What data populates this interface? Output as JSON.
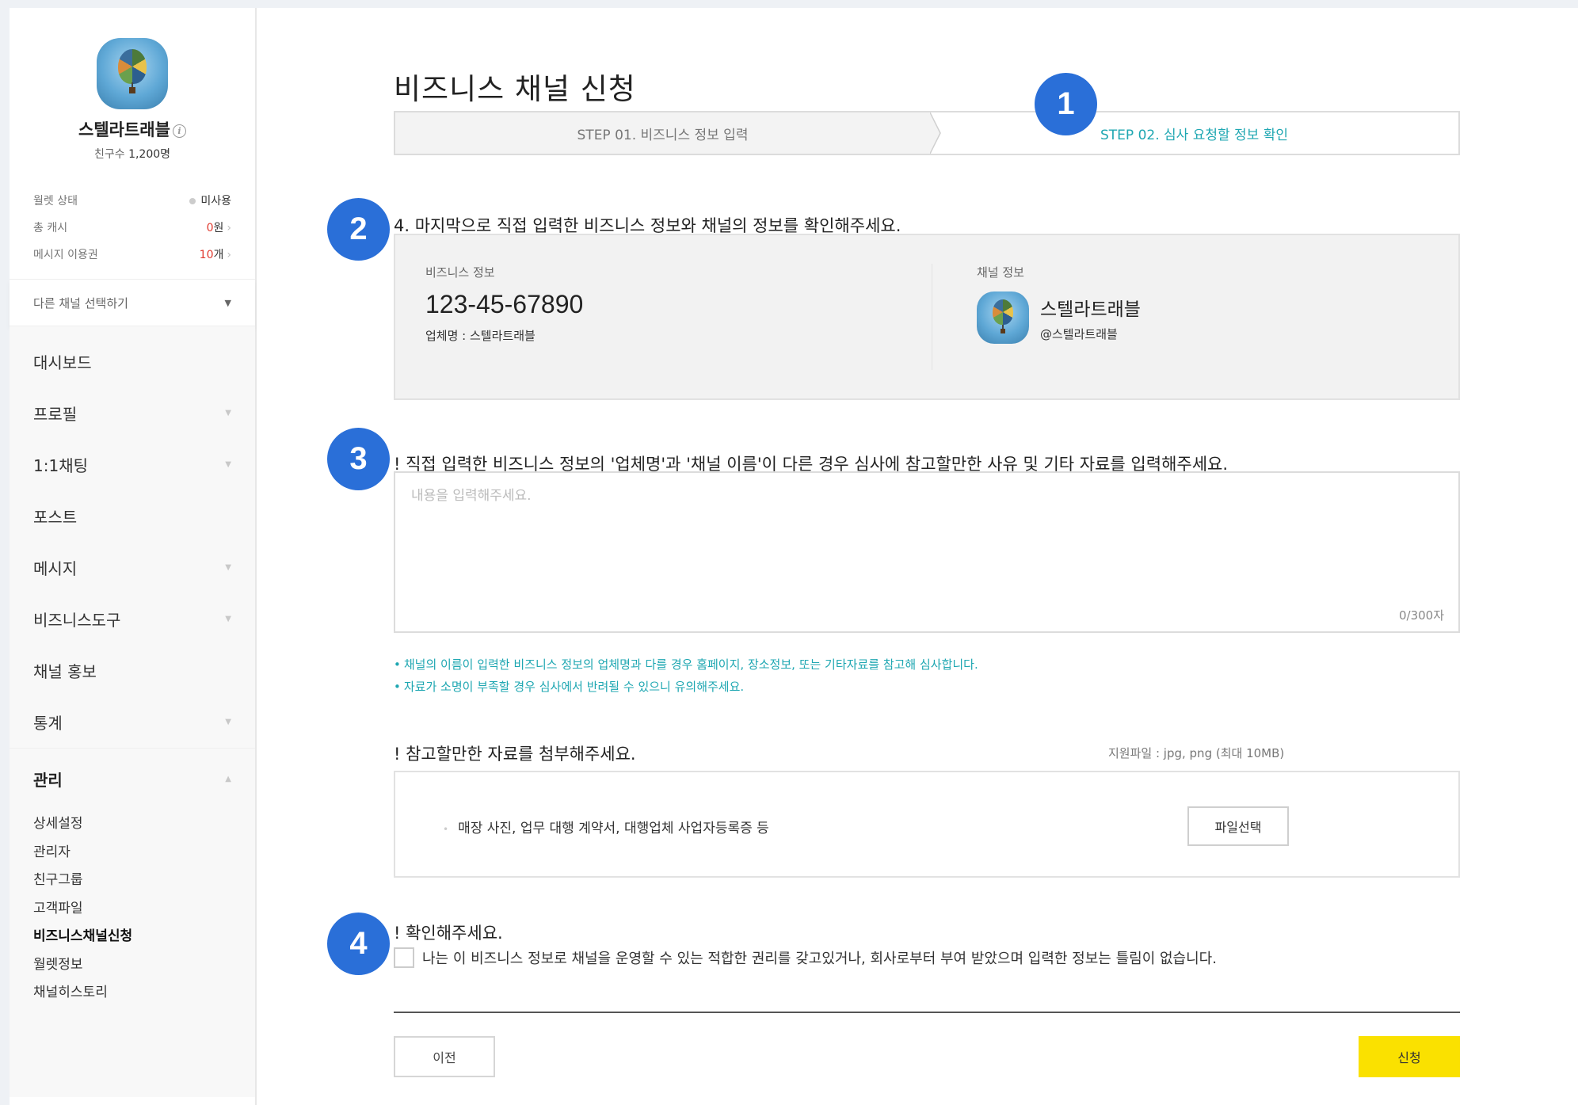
{
  "sidebar": {
    "channel_name": "스텔라트래블",
    "friends_label": "친구수",
    "friends_count": "1,200명",
    "stats": [
      {
        "label": "월렛 상태",
        "value": "미사용"
      },
      {
        "label": "총 캐시",
        "value": "0",
        "unit": "원"
      },
      {
        "label": "메시지 이용권",
        "value": "10",
        "unit": "개"
      }
    ],
    "channel_select": "다른 채널 선택하기",
    "nav": [
      "대시보드",
      "프로필",
      "1:1채팅",
      "포스트",
      "메시지",
      "비즈니스도구",
      "채널 홍보",
      "통계"
    ],
    "manage_label": "관리",
    "manage_items": [
      "상세설정",
      "관리자",
      "친구그룹",
      "고객파일",
      "비즈니스채널신청",
      "월렛정보",
      "채널히스토리"
    ]
  },
  "main": {
    "title": "비즈니스 채널 신청",
    "step1": "STEP 01. 비즈니스 정보 입력",
    "step2": "STEP 02. 심사 요청할 정보 확인",
    "badges": [
      "1",
      "2",
      "3",
      "4"
    ],
    "section4_label": "4. 마지막으로 직접 입력한 비즈니스 정보와 채널의 정보를 확인해주세요.",
    "biz_label": "비즈니스 정보",
    "biz_number": "123-45-67890",
    "biz_company": "업체명 : 스텔라트래블",
    "chan_label": "채널 정보",
    "chan_name": "스텔라트래블",
    "chan_handle": "@스텔라트래블",
    "reason_label": "! 직접 입력한 비즈니스 정보의 '업체명'과 '채널 이름'이 다른 경우 심사에 참고할만한 사유 및 기타 자료를 입력해주세요.",
    "reason_placeholder": "내용을 입력해주세요.",
    "reason_counter": "0/300자",
    "notes": [
      "채널의 이름이 입력한 비즈니스 정보의 업체명과 다를 경우 홈페이지, 장소정보, 또는 기타자료를 참고해 심사합니다.",
      "자료가 소명이 부족할 경우 심사에서 반려될 수 있으니 유의해주세요."
    ],
    "attach_title": "! 참고할만한 자료를 첨부해주세요.",
    "attach_hint": "지원파일 : jpg, png (최대 10MB)",
    "attach_item": "매장 사진, 업무 대행 계약서, 대행업체 사업자등록증 등",
    "file_button": "파일선택",
    "confirm_title": "! 확인해주세요.",
    "confirm_text": "나는 이 비즈니스 정보로 채널을 운영할 수 있는 적합한 권리를 갖고있거나, 회사로부터 부여 받았으며 입력한 정보는 틀림이 없습니다.",
    "prev_button": "이전",
    "submit_button": "신청"
  },
  "colors": {
    "accent_teal": "#1fa7b2",
    "badge_blue": "#2a6fd8",
    "submit_yellow": "#fae100",
    "warn_red": "#e03a2f"
  }
}
